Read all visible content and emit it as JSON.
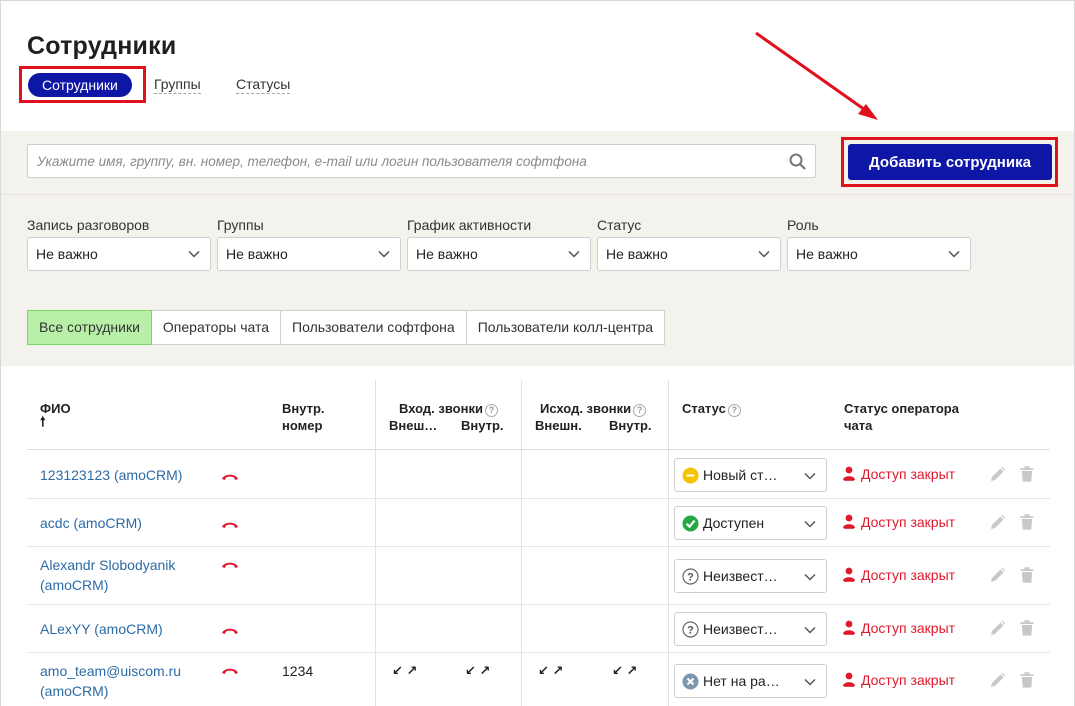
{
  "page": {
    "title": "Сотрудники"
  },
  "tabs": [
    {
      "label": "Сотрудники",
      "active": true
    },
    {
      "label": "Группы",
      "active": false
    },
    {
      "label": "Статусы",
      "active": false
    }
  ],
  "search": {
    "placeholder": "Укажите имя, группу, вн. номер, телефон, e-mail или логин пользователя софтфона",
    "value": ""
  },
  "add_button": {
    "label": "Добавить сотрудника"
  },
  "filters": [
    {
      "label": "Запись разговоров",
      "value": "Не важно"
    },
    {
      "label": "Группы",
      "value": "Не важно"
    },
    {
      "label": "График активности",
      "value": "Не важно"
    },
    {
      "label": "Статус",
      "value": "Не важно"
    },
    {
      "label": "Роль",
      "value": "Не важно"
    }
  ],
  "segments": [
    {
      "label": "Все сотрудники",
      "active": true
    },
    {
      "label": "Операторы чата",
      "active": false
    },
    {
      "label": "Пользователи софтфона",
      "active": false
    },
    {
      "label": "Пользователи колл-центра",
      "active": false
    }
  ],
  "table": {
    "headers": {
      "name": "ФИО",
      "sort_arrow": "🠕",
      "ext_line1": "Внутр.",
      "ext_line2": "номер",
      "incoming": "Вход. звонки",
      "incoming_external": "Внеш…",
      "incoming_internal": "Внутр.",
      "outgoing": "Исход. звонки",
      "outgoing_external": "Внешн.",
      "outgoing_internal": "Внутр.",
      "status": "Статус",
      "chat_status_line1": "Статус оператора",
      "chat_status_line2": "чата",
      "help_glyph": "?"
    },
    "rows": [
      {
        "name_line1": "123123123 (amoCRM)",
        "name_line2": "",
        "ext": "",
        "in_ext": "",
        "in_int": "",
        "out_ext": "",
        "out_int": "",
        "status": "Новый ст…",
        "status_kind": "new",
        "chat_status": "Доступ закрыт"
      },
      {
        "name_line1": "acdc (amoCRM)",
        "name_line2": "",
        "ext": "",
        "in_ext": "",
        "in_int": "",
        "out_ext": "",
        "out_int": "",
        "status": "Доступен",
        "status_kind": "available",
        "chat_status": "Доступ закрыт"
      },
      {
        "name_line1": "Alexandr Slobodyanik",
        "name_line2": "(amoCRM)",
        "ext": "",
        "in_ext": "",
        "in_int": "",
        "out_ext": "",
        "out_int": "",
        "status": "Неизвест…",
        "status_kind": "unknown",
        "chat_status": "Доступ закрыт"
      },
      {
        "name_line1": "ALexYY (amoCRM)",
        "name_line2": "",
        "ext": "",
        "in_ext": "",
        "in_int": "",
        "out_ext": "",
        "out_int": "",
        "status": "Неизвест…",
        "status_kind": "unknown",
        "chat_status": "Доступ закрыт"
      },
      {
        "name_line1": "amo_team@uiscom.ru",
        "name_line2": "(amoCRM)",
        "ext": "1234",
        "in_ext": "↙ ↗",
        "in_int": "↙ ↗",
        "out_ext": "↙ ↗",
        "out_int": "↙ ↗",
        "status": "Нет на ра…",
        "status_kind": "away",
        "chat_status": "Доступ закрыт"
      }
    ]
  },
  "colors": {
    "brand": "#0e16a6",
    "highlight": "#e0101c",
    "link": "#2b6ba6",
    "danger": "#e0192c",
    "active_segment": "#b9f0a8"
  },
  "icons": [
    "search-icon",
    "chevron-down-icon",
    "hangup-phone-icon",
    "help-icon",
    "person-icon",
    "pencil-icon",
    "trash-icon",
    "status-new-icon",
    "status-available-icon",
    "status-unknown-icon",
    "status-away-icon"
  ]
}
